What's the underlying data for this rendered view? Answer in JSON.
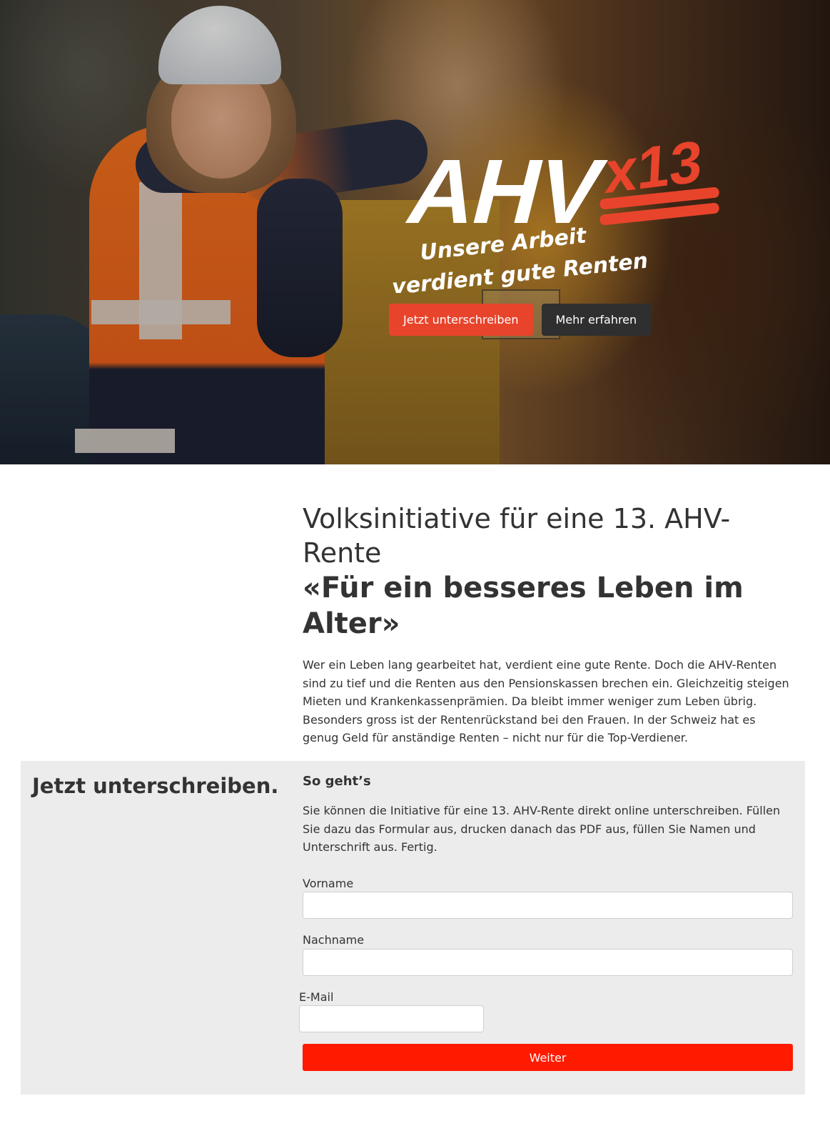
{
  "hero": {
    "logo_main": "AHV",
    "logo_badge": "x13",
    "tagline_line1": "Unsere Arbeit",
    "tagline_line2": "verdient gute Renten",
    "sign_button": "Jetzt unterschreiben",
    "more_button": "Mehr erfahren"
  },
  "intro": {
    "title": "Volksinitiative für eine 13. AHV-Rente",
    "subtitle": "«Für ein besseres Leben im Alter»",
    "text": "Wer ein Leben lang gearbeitet hat, verdient eine gute Rente. Doch die AHV-Renten sind zu tief und die Renten aus den Pensionskassen brechen ein. Gleichzeitig steigen Mieten und Krankenkassenprämien. Da bleibt immer weniger zum Leben übrig. Besonders gross ist der Rentenrückstand bei den Frauen. In der Schweiz hat es genug Geld für anständige Renten – nicht nur für die Top-Verdiener."
  },
  "sign": {
    "heading": "Jetzt unterschreiben.",
    "howto_title": "So geht’s",
    "howto_text": "Sie können die Initiative für eine 13. AHV-Rente direkt online unterschreiben. Füllen Sie dazu das Formular aus, drucken danach das PDF aus, füllen Sie Namen und Unterschrift aus. Fertig.",
    "form": {
      "first_name_label": "Vorname",
      "first_name_value": "",
      "last_name_label": "Nachname",
      "last_name_value": "",
      "email_label": "E-Mail",
      "email_value": "",
      "submit_label": "Weiter"
    }
  },
  "colors": {
    "accent_red": "#e8442c",
    "submit_red": "#ff1a00",
    "dark_button": "#2f2f2f",
    "section_bg": "#ececec"
  }
}
